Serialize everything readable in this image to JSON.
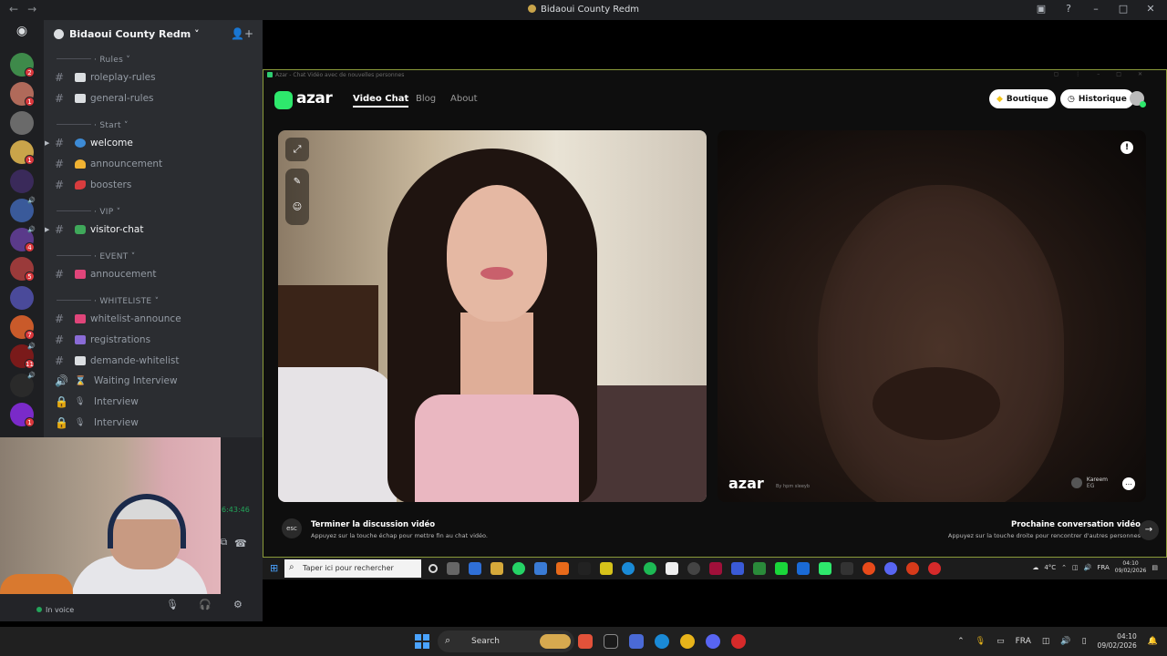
{
  "titlebar": {
    "title": "Bidaoui County Redm"
  },
  "server": {
    "name": "Bidaoui County Redm"
  },
  "rail": {
    "servers": [
      {
        "color": "#3e8a4a",
        "badge": "2",
        "vol": false
      },
      {
        "color": "#b06a5a",
        "badge": "1",
        "vol": false
      },
      {
        "color": "#6a6a6a",
        "badge": "",
        "vol": false
      },
      {
        "color": "#c9a44a",
        "badge": "1",
        "vol": false
      },
      {
        "color": "#3a2a5a",
        "badge": "",
        "vol": false
      },
      {
        "color": "#3a5a9a",
        "badge": "",
        "vol": true
      },
      {
        "color": "#5a3a8a",
        "badge": "4",
        "vol": true
      },
      {
        "color": "#9a3a3a",
        "badge": "5",
        "vol": false
      },
      {
        "color": "#4a4a9a",
        "badge": "",
        "vol": false
      },
      {
        "color": "#c95a2a",
        "badge": "7",
        "vol": false
      },
      {
        "color": "#7a1a1a",
        "badge": "11",
        "vol": true
      },
      {
        "color": "#2a2a2a",
        "badge": "",
        "vol": true
      },
      {
        "color": "#7a2ac9",
        "badge": "1",
        "vol": false
      }
    ]
  },
  "categories": {
    "rules": "Rules",
    "start": "Start",
    "vip": "VIP",
    "event": "EVENT",
    "whiteliste": "WHITELISTE"
  },
  "channels": {
    "roleplay_rules": "roleplay-rules",
    "general_rules": "general-rules",
    "welcome": "welcome",
    "announcement": "announcement",
    "boosters": "boosters",
    "visitor_chat": "visitor-chat",
    "annoucement": "annoucement",
    "whitelist_announce": "whitelist-announce",
    "registrations": "registrations",
    "demande_whitelist": "demande-whitelist",
    "waiting_interview": "Waiting Interview",
    "interview_1": "Interview",
    "interview_2": "Interview"
  },
  "voice": {
    "timer": "6:43:46",
    "status": "In voice"
  },
  "azar": {
    "window_title": "Azar - Chat Vidéo avec de nouvelles personnes",
    "logo": "azar",
    "nav": {
      "video_chat": "Video Chat",
      "blog": "Blog",
      "about": "About"
    },
    "boutique": "Boutique",
    "historique": "Historique",
    "watermark": "azar",
    "watermark_sub": "By hpm sleeyb",
    "peer_name": "Kareem",
    "peer_country": "EG",
    "esc_label": "esc",
    "end_title": "Terminer la discussion vidéo",
    "end_sub": "Appuyez sur la touche échap pour mettre fin au chat vidéo.",
    "next_title": "Prochaine conversation vidéo",
    "next_sub": "Appuyez sur la touche droite pour rencontrer d'autres personnes"
  },
  "inner_taskbar": {
    "search_placeholder": "Taper ici pour rechercher",
    "temp": "4°C",
    "lang": "FRA",
    "time": "04:10",
    "date": "09/02/2026"
  },
  "taskbar": {
    "search_label": "Search",
    "lang": "FRA",
    "time": "04:10",
    "date": "09/02/2026"
  }
}
